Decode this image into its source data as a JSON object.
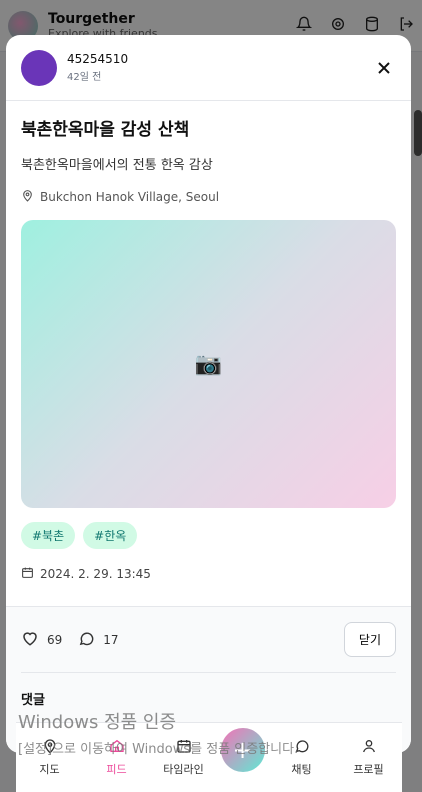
{
  "app": {
    "name": "Tourgether",
    "subtitle": "Explore with friends"
  },
  "post": {
    "author": "45254510",
    "time_ago": "42일 전",
    "title": "북촌한옥마을 감성 산책",
    "description": "북촌한옥마을에서의 전통 한옥 감상",
    "location": "Bukchon Hanok Village, Seoul",
    "tags": [
      "#북촌",
      "#한옥"
    ],
    "date": "2024. 2. 29. 13:45",
    "likes": "69",
    "comments": "17"
  },
  "actions": {
    "close_label": "닫기"
  },
  "comments_section": {
    "title": "댓글"
  },
  "nav": {
    "items": [
      {
        "label": "지도"
      },
      {
        "label": "피드"
      },
      {
        "label": "타임라인"
      },
      {
        "label": "채팅"
      },
      {
        "label": "프로필"
      }
    ]
  },
  "watermark": {
    "line1": "Windows 정품 인증",
    "line2": "[설정]으로 이동하여 Windows를 정품 인증합니다."
  },
  "colors": {
    "accent": "#ec4899",
    "tag_bg": "#d1fae5",
    "tag_text": "#0f766e",
    "avatar": "#6a35b8"
  }
}
